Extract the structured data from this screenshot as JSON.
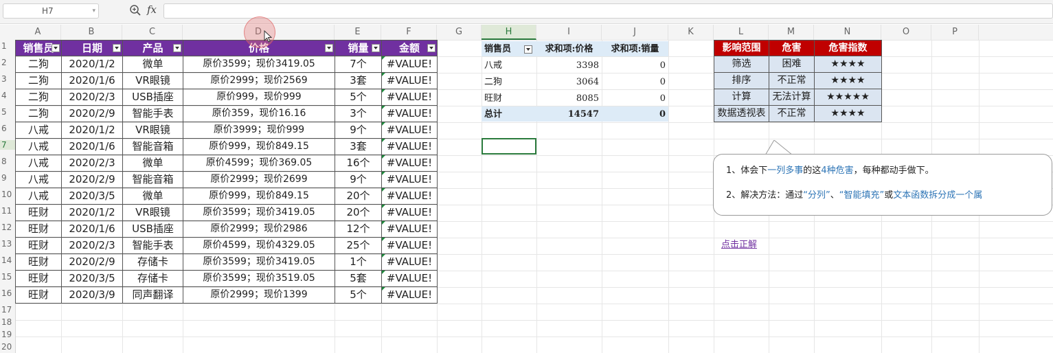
{
  "toolbar": {
    "name_box": "H7",
    "fx_label": "fx",
    "formula_value": ""
  },
  "columns": [
    "A",
    "B",
    "C",
    "D",
    "E",
    "F",
    "G",
    "H",
    "I",
    "J",
    "K",
    "L",
    "M",
    "N",
    "O",
    "P"
  ],
  "rows": [
    "1",
    "2",
    "3",
    "4",
    "5",
    "6",
    "7",
    "8",
    "9",
    "10",
    "11",
    "12",
    "13",
    "14",
    "15",
    "16",
    "17",
    "18",
    "19",
    "20"
  ],
  "sales_table": {
    "headers": [
      "销售员",
      "日期",
      "产品",
      "价格",
      "销量",
      "金额"
    ],
    "rows": [
      [
        "二狗",
        "2020/1/2",
        "微单",
        "原价3599；现价3419.05",
        "7个",
        "#VALUE!"
      ],
      [
        "二狗",
        "2020/1/6",
        "VR眼镜",
        "原价2999；现价2569",
        "3套",
        "#VALUE!"
      ],
      [
        "二狗",
        "2020/2/3",
        "USB插座",
        "原价999，现价999",
        "5个",
        "#VALUE!"
      ],
      [
        "二狗",
        "2020/2/9",
        "智能手表",
        "原价359，现价16.16",
        "3个",
        "#VALUE!"
      ],
      [
        "八戒",
        "2020/1/2",
        "VR眼镜",
        "原价3999；现价999",
        "9个",
        "#VALUE!"
      ],
      [
        "八戒",
        "2020/1/6",
        "智能音箱",
        "原价999，现价849.15",
        "3套",
        "#VALUE!"
      ],
      [
        "八戒",
        "2020/2/3",
        "微单",
        "原价4599；现价369.05",
        "16个",
        "#VALUE!"
      ],
      [
        "八戒",
        "2020/2/9",
        "智能音箱",
        "原价2999；现价2699",
        "9个",
        "#VALUE!"
      ],
      [
        "八戒",
        "2020/3/5",
        "微单",
        "原价999，现价849.15",
        "20个",
        "#VALUE!"
      ],
      [
        "旺财",
        "2020/1/2",
        "VR眼镜",
        "原价3599；现价3419.05",
        "20个",
        "#VALUE!"
      ],
      [
        "旺财",
        "2020/1/6",
        "USB插座",
        "原价2999；现价2986",
        "12个",
        "#VALUE!"
      ],
      [
        "旺财",
        "2020/2/3",
        "智能手表",
        "原价4599，现价4329.05",
        "25个",
        "#VALUE!"
      ],
      [
        "旺财",
        "2020/2/9",
        "存储卡",
        "原价3599；现价3419.05",
        "1个",
        "#VALUE!"
      ],
      [
        "旺财",
        "2020/3/5",
        "存储卡",
        "原价3599；现价3519.05",
        "5套",
        "#VALUE!"
      ],
      [
        "旺财",
        "2020/3/9",
        "同声翻译",
        "原价2999；现价1399",
        "5个",
        "#VALUE!"
      ]
    ]
  },
  "pivot": {
    "headers": [
      "销售员",
      "求和项:价格",
      "求和项:销量"
    ],
    "rows": [
      [
        "八戒",
        "3398",
        "0"
      ],
      [
        "二狗",
        "3064",
        "0"
      ],
      [
        "旺财",
        "8085",
        "0"
      ]
    ],
    "total": [
      "总计",
      "14547",
      "0"
    ]
  },
  "harm_table": {
    "headers": [
      "影响范围",
      "危害",
      "危害指数"
    ],
    "rows": [
      [
        "筛选",
        "困难",
        "★★★★"
      ],
      [
        "排序",
        "不正常",
        "★★★★"
      ],
      [
        "计算",
        "无法计算",
        "★★★★★"
      ],
      [
        "数据透视表",
        "不正常",
        "★★★★"
      ]
    ]
  },
  "callout": {
    "line1_a": "1、体会下",
    "line1_b": "一列多事",
    "line1_c": "的这",
    "line1_d": "4种危害",
    "line1_e": "，每种都动手做下。",
    "line2_a": "2、解决方法：通过",
    "line2_b": "“分列”",
    "line2_c": "、",
    "line2_d": "“智能填充”",
    "line2_e": "或",
    "line2_f": "文本函数拆分成一个属"
  },
  "answer_link": "点击正解",
  "colors": {
    "purple_header": "#7030a0",
    "red_header": "#c00000",
    "pivot_fill": "#ddebf7",
    "harm_fill": "#dbe5f1",
    "selection": "#2a7a3c",
    "highlight": "#2e75b6"
  }
}
